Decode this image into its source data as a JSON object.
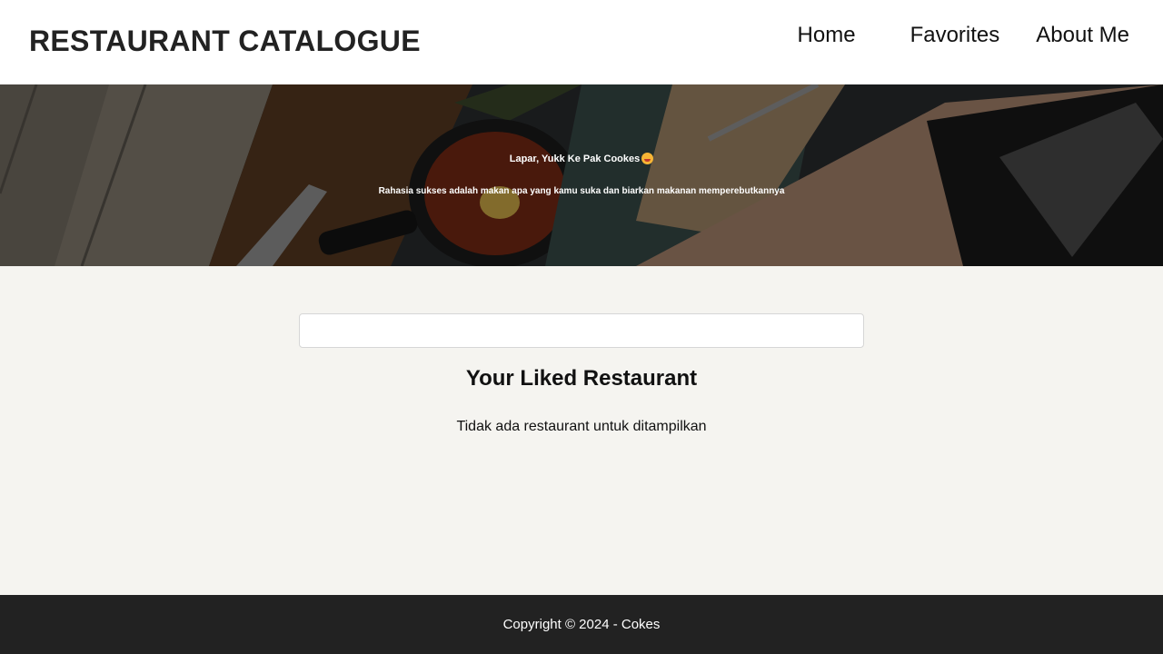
{
  "header": {
    "brand": "RESTAURANT CATALOGUE",
    "nav": [
      {
        "label": "Home"
      },
      {
        "label": "Favorites"
      },
      {
        "label": "About Me"
      }
    ]
  },
  "hero": {
    "title": "Lapar, Yukk Ke Pak Cookes",
    "title_emoji": "smiling-face-emoji",
    "subtitle": "Rahasia sukses adalah makan apa yang kamu suka dan biarkan makanan memperebutkannya"
  },
  "main": {
    "search": {
      "value": "",
      "placeholder": ""
    },
    "title": "Your Liked Restaurant",
    "empty_message": "Tidak ada restaurant untuk ditampilkan"
  },
  "footer": {
    "text": "Copyright © 2024 - Cokes"
  },
  "colors": {
    "header_bg": "#ffffff",
    "page_bg": "#f5f4f0",
    "footer_bg": "#222222",
    "text": "#111111"
  }
}
